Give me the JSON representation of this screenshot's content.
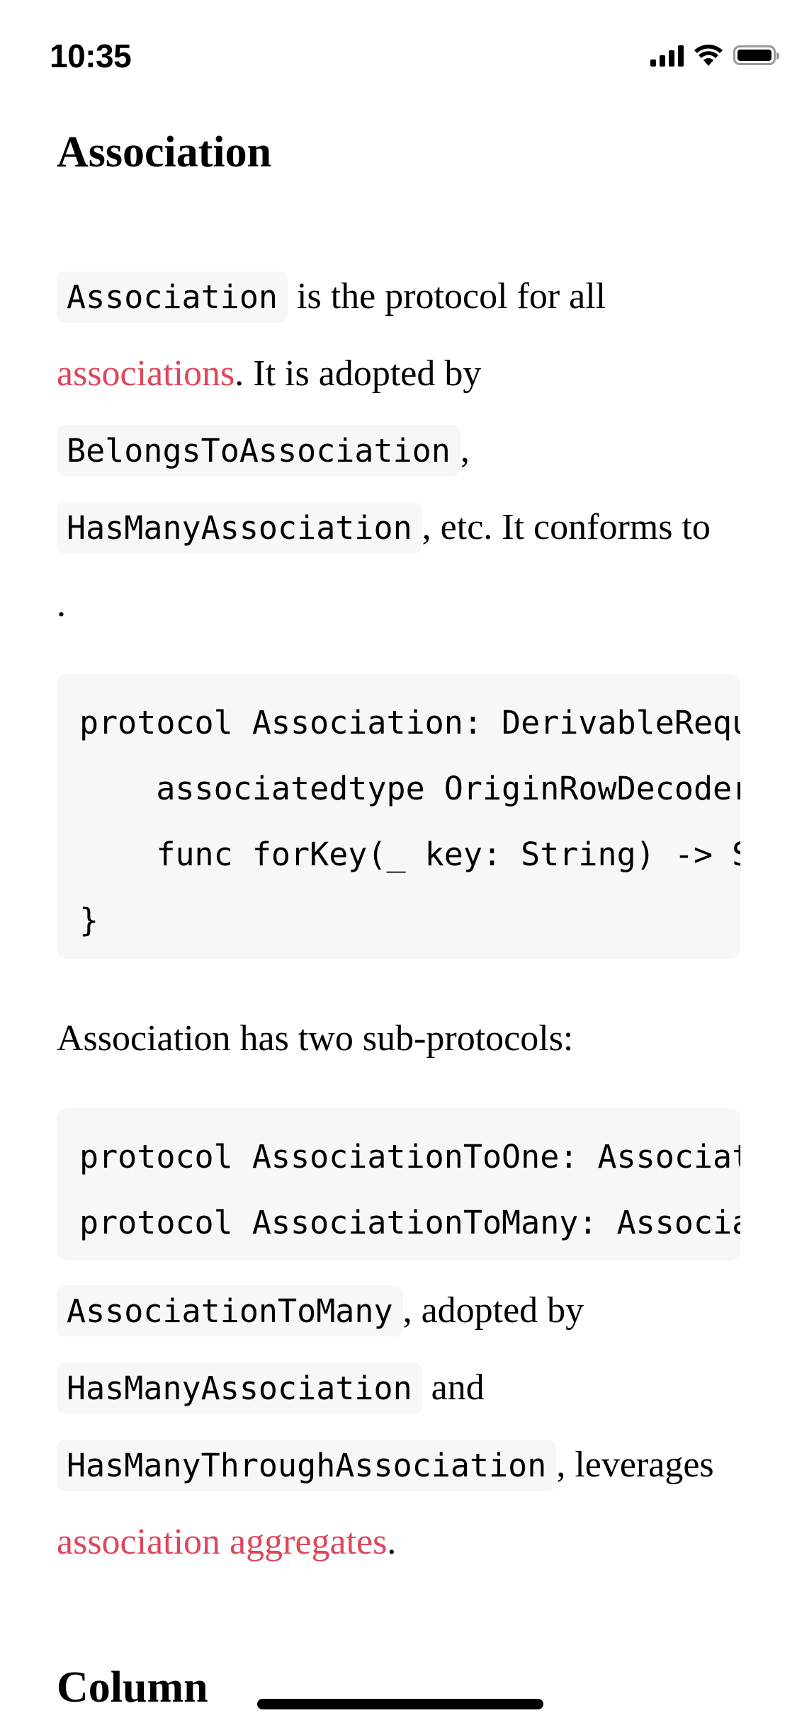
{
  "status_bar": {
    "time": "10:35",
    "icons": [
      "cellular-signal-icon",
      "wifi-icon",
      "battery-icon"
    ]
  },
  "colors": {
    "link": "#e0455a",
    "code_background": "#f7f7f7",
    "text": "#000000"
  },
  "section": {
    "title": "Association",
    "paragraph1": {
      "code1": "Association",
      "text1": " is the protocol for all ",
      "link1": "associations",
      "text2": ". It is adopted by ",
      "code2": "BelongsToAssociation",
      "text3": ", ",
      "code3": "HasManyAssociation",
      "text4": ", etc. It conforms to ",
      "text5": "."
    },
    "code_block1": [
      "protocol Association: DerivableRequ",
      "    associatedtype OriginRowDecoder",
      "    func forKey(_ key: String) -> S",
      "}"
    ],
    "paragraph2": "Association has two sub-protocols:",
    "code_block2": [
      "protocol AssociationToOne: Associat",
      "protocol AssociationToMany: Associa"
    ],
    "paragraph3": {
      "code1": "AssociationToMany",
      "text1": ", adopted by ",
      "code2": "HasManyAssociation",
      "text2": " and ",
      "code3": "HasManyThroughAssociation",
      "text3": ", leverages ",
      "link1": "association aggregates",
      "text4": "."
    }
  },
  "next_section": {
    "title": "Column"
  }
}
